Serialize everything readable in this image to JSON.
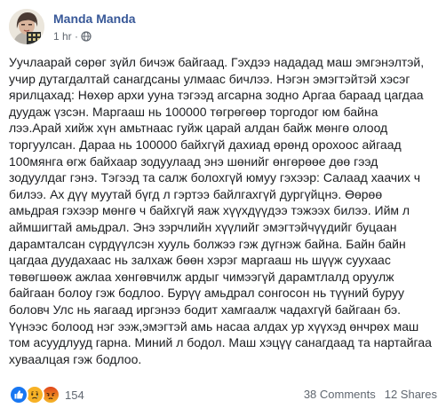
{
  "post": {
    "author": "Manda Manda",
    "time": "1 hr",
    "privacy_icon": "globe-icon",
    "text_lines": [
      "Уучлаарай сөрөг зүйл бичэж байгаад. Гэхдээ нададад маш эмгэнэлтэй,",
      "учир дутагдалтай санагдсаны улмаас бичлээ. Нэгэн эмэгтэйтэй хэсэг",
      "ярилцахад: Нөхөр архи ууна тэгээд агсарна зодно Аргаа бараад цагдаа",
      "дуудаж үзсэн. Маргааш нь 100000 төгрөгөөр торгодог юм байна",
      "лээ.Арай хийж хүн амьтнаас гуйж царай алдан байж мөнгө олоод",
      "торгуулсан. Дараа нь 100000 байхгүй дахиад өрөнд орохоос айгаад",
      "100мянга өгж байхаар зодуулаад энэ шөнийг өнгөрөөе дөө гээд",
      "зодуулдаг гэнэ. Тэгээд та салж болохгүй юмуу гэхээр: Салаад хаачих ч",
      "билээ. Ах дүү муутай бүгд л гэртээ байлгахгүй дургүйцнэ. Өөрөө",
      "амьдрая гэхээр мөнгө ч байхгүй яаж хүүхдүүдээ тэжээх билээ. Ийм л",
      "аймшигтай амьдрал. Энэ зэрчлийн хүүлийг эмэгтэйчүүдийг буцаан",
      "дарамталсан сүрдүүлсэн хууль болжээ гэж дүгнэж байна. Байн байн",
      "цагдаа дуудахаас нь залхаж бөөн хэрэг маргааш нь шүүж суухаас",
      "төвөгшөөж ажлаа хөнгөвчилж ардыг чимээгүй дарамтлалд оруулж",
      "байгаан болоу гэж бодлоо. Бурүү амьдрал сонгосон нь түүний буруу",
      "боловч Улс нь яагаад иргэнээ бодит хамгаалж чадахгүй байгаан бэ.",
      "Үүнээс болоод нэг ээж,эмэгтэй амь насаа алдах ур хүүхэд өнчрөх маш",
      "том асуудлууд гарна. Миний л бодол. Маш хэцүү санагдаад та нартайгаа",
      "хуваалцая гэж бодлоо."
    ]
  },
  "reactions": {
    "icons": [
      "like-icon",
      "sad-icon",
      "angry-icon"
    ],
    "count": "154",
    "colors": {
      "like": "#1877f2",
      "sad": "#f7b125",
      "angry": "#e9710f"
    }
  },
  "stats": {
    "comments": "38 Comments",
    "shares": "12 Shares"
  },
  "colors": {
    "author": "#385898",
    "text": "#1c1e21",
    "meta": "#606770"
  }
}
